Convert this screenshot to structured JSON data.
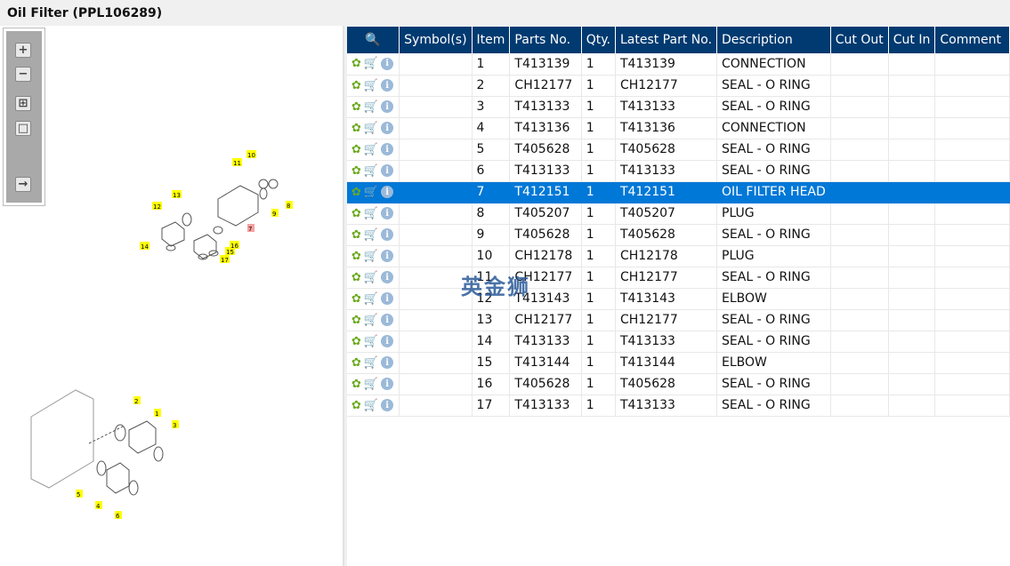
{
  "title": "Oil Filter (PPL106289)",
  "toolbar": [
    "zoom-in",
    "zoom-out",
    "fit-all",
    "fit-window",
    "toggle-panel"
  ],
  "diagram": {
    "callouts": [
      "1",
      "2",
      "3",
      "4",
      "5",
      "6",
      "8",
      "9",
      "10",
      "11",
      "12",
      "13",
      "14",
      "15",
      "16",
      "17",
      "7"
    ]
  },
  "table": {
    "headers": [
      "",
      "Symbol(s)",
      "Item",
      "Parts No.",
      "Qty.",
      "Latest Part No.",
      "Description",
      "Cut Out",
      "Cut In",
      "Comment"
    ],
    "selected_item": "7",
    "rows": [
      [
        "1",
        "T413139",
        "1",
        "T413139",
        "CONNECTION"
      ],
      [
        "2",
        "CH12177",
        "1",
        "CH12177",
        "SEAL - O RING"
      ],
      [
        "3",
        "T413133",
        "1",
        "T413133",
        "SEAL - O RING"
      ],
      [
        "4",
        "T413136",
        "1",
        "T413136",
        "CONNECTION"
      ],
      [
        "5",
        "T405628",
        "1",
        "T405628",
        "SEAL - O RING"
      ],
      [
        "6",
        "T413133",
        "1",
        "T413133",
        "SEAL - O RING"
      ],
      [
        "7",
        "T412151",
        "1",
        "T412151",
        "OIL FILTER HEAD"
      ],
      [
        "8",
        "T405207",
        "1",
        "T405207",
        "PLUG"
      ],
      [
        "9",
        "T405628",
        "1",
        "T405628",
        "SEAL - O RING"
      ],
      [
        "10",
        "CH12178",
        "1",
        "CH12178",
        "PLUG"
      ],
      [
        "11",
        "CH12177",
        "1",
        "CH12177",
        "SEAL - O RING"
      ],
      [
        "12",
        "T413143",
        "1",
        "T413143",
        "ELBOW"
      ],
      [
        "13",
        "CH12177",
        "1",
        "CH12177",
        "SEAL - O RING"
      ],
      [
        "14",
        "T413133",
        "1",
        "T413133",
        "SEAL - O RING"
      ],
      [
        "15",
        "T413144",
        "1",
        "T413144",
        "ELBOW"
      ],
      [
        "16",
        "T405628",
        "1",
        "T405628",
        "SEAL - O RING"
      ],
      [
        "17",
        "T413133",
        "1",
        "T413133",
        "SEAL - O RING"
      ]
    ]
  },
  "watermark": "英金狮",
  "colors": {
    "header": "#003a70",
    "selected": "#0078d7",
    "callout": "#ffff00"
  }
}
